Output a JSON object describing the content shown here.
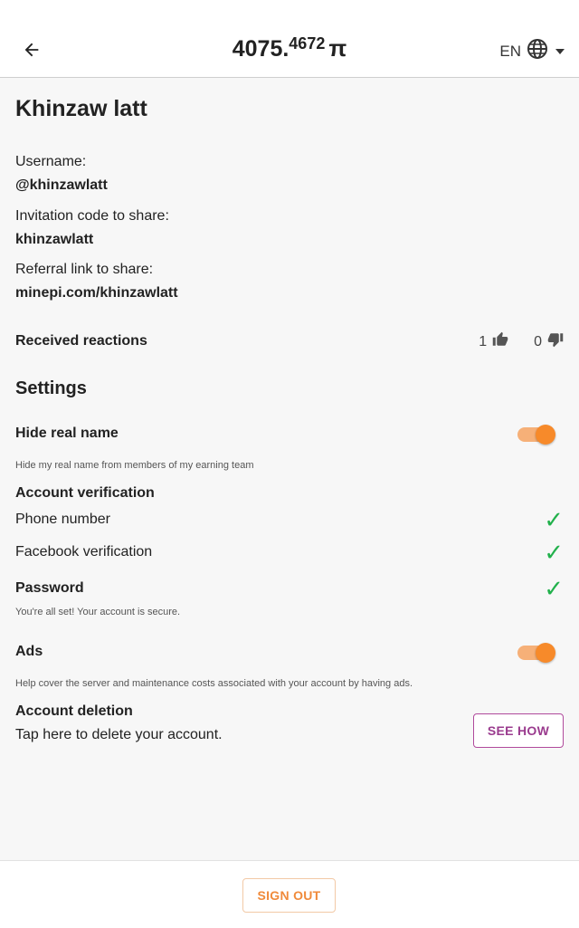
{
  "header": {
    "balance_int": "4075.",
    "balance_dec": "4672",
    "currency": "π",
    "language": "EN"
  },
  "profile": {
    "name": "Khinzaw latt",
    "username_label": "Username:",
    "username": "@khinzawlatt",
    "invite_label": "Invitation code to share:",
    "invite_code": "khinzawlatt",
    "referral_label": "Referral link to share:",
    "referral_link": "minepi.com/khinzawlatt"
  },
  "reactions": {
    "label": "Received reactions",
    "likes": "1",
    "dislikes": "0"
  },
  "settings": {
    "title": "Settings",
    "hide_name_title": "Hide real name",
    "hide_name_desc": "Hide my real name from members of my earning team",
    "hide_name_enabled": true,
    "verification_title": "Account verification",
    "phone_label": "Phone number",
    "facebook_label": "Facebook verification",
    "password_title": "Password",
    "password_desc": "You're all set! Your account is secure.",
    "ads_title": "Ads",
    "ads_desc": "Help cover the server and maintenance costs associated with your account by having ads.",
    "ads_enabled": true,
    "deletion_title": "Account deletion",
    "deletion_desc": "Tap here to delete your account.",
    "see_how_label": "SEE HOW"
  },
  "footer": {
    "sign_out_label": "SIGN OUT"
  },
  "colors": {
    "accent_orange": "#f78a2a",
    "check_green": "#22b14c",
    "purple": "#9a3b8e"
  }
}
